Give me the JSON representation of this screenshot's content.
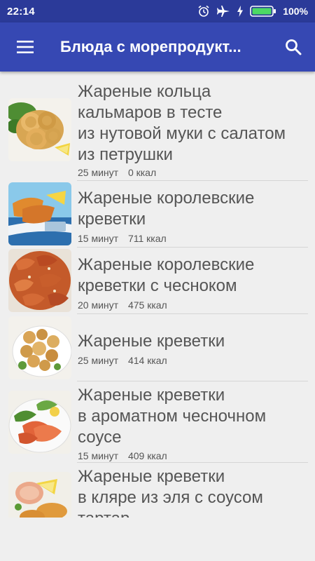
{
  "status_bar": {
    "time": "22:14",
    "battery_percent": "100%",
    "icons": [
      "alarm-icon",
      "airplane-mode-icon",
      "charging-icon",
      "battery-icon"
    ]
  },
  "app_bar": {
    "title": "Блюда с морепродукт...",
    "menu_icon": "hamburger-menu-icon",
    "search_icon": "search-icon",
    "color": "#3648b3"
  },
  "recipes": [
    {
      "title": "Жареные кольца\nкальмаров в тесте\nиз нутовой муки с салатом\nиз петрушки",
      "time": "25 минут",
      "calories": "0 ккал",
      "image": "fried-calamari-rings"
    },
    {
      "title": "Жареные королевские\nкреветки",
      "time": "15 минут",
      "calories": "711 ккал",
      "image": "fried-king-prawns"
    },
    {
      "title": "Жареные королевские\nкреветки с чесноком",
      "time": "20 минут",
      "calories": "475 ккал",
      "image": "garlic-king-prawns"
    },
    {
      "title": "Жареные креветки",
      "time": "25 минут",
      "calories": "414 ккал",
      "image": "fried-shrimp"
    },
    {
      "title": "Жареные креветки\nв ароматном чесночном\nсоусе",
      "time": "15 минут",
      "calories": "409 ккал",
      "image": "shrimp-garlic-sauce"
    },
    {
      "title": "Жареные креветки\nв кляре из эля с соусом\nтартар",
      "time": "",
      "calories": "",
      "image": "beer-battered-shrimp"
    }
  ]
}
